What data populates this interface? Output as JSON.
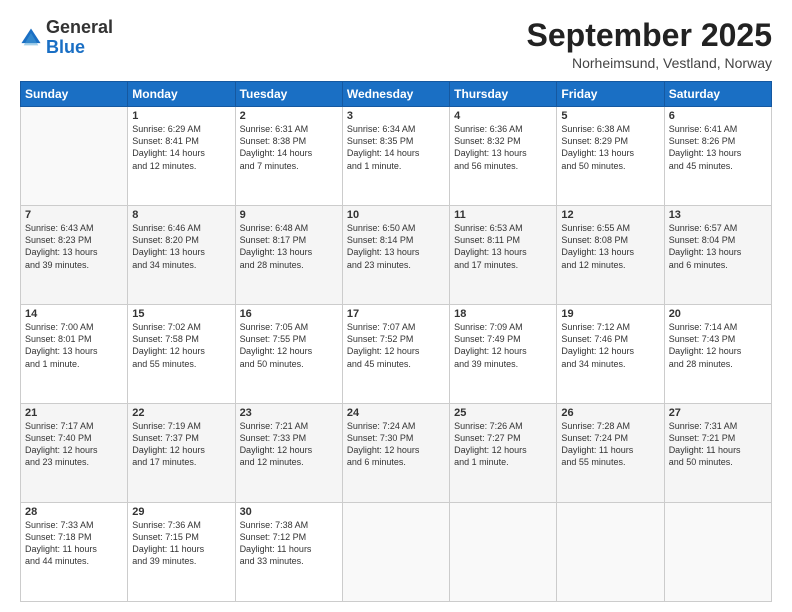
{
  "header": {
    "logo_general": "General",
    "logo_blue": "Blue",
    "month_title": "September 2025",
    "location": "Norheimsund, Vestland, Norway"
  },
  "days_of_week": [
    "Sunday",
    "Monday",
    "Tuesday",
    "Wednesday",
    "Thursday",
    "Friday",
    "Saturday"
  ],
  "weeks": [
    [
      {
        "day": "",
        "content": ""
      },
      {
        "day": "1",
        "content": "Sunrise: 6:29 AM\nSunset: 8:41 PM\nDaylight: 14 hours\nand 12 minutes."
      },
      {
        "day": "2",
        "content": "Sunrise: 6:31 AM\nSunset: 8:38 PM\nDaylight: 14 hours\nand 7 minutes."
      },
      {
        "day": "3",
        "content": "Sunrise: 6:34 AM\nSunset: 8:35 PM\nDaylight: 14 hours\nand 1 minute."
      },
      {
        "day": "4",
        "content": "Sunrise: 6:36 AM\nSunset: 8:32 PM\nDaylight: 13 hours\nand 56 minutes."
      },
      {
        "day": "5",
        "content": "Sunrise: 6:38 AM\nSunset: 8:29 PM\nDaylight: 13 hours\nand 50 minutes."
      },
      {
        "day": "6",
        "content": "Sunrise: 6:41 AM\nSunset: 8:26 PM\nDaylight: 13 hours\nand 45 minutes."
      }
    ],
    [
      {
        "day": "7",
        "content": "Sunrise: 6:43 AM\nSunset: 8:23 PM\nDaylight: 13 hours\nand 39 minutes."
      },
      {
        "day": "8",
        "content": "Sunrise: 6:46 AM\nSunset: 8:20 PM\nDaylight: 13 hours\nand 34 minutes."
      },
      {
        "day": "9",
        "content": "Sunrise: 6:48 AM\nSunset: 8:17 PM\nDaylight: 13 hours\nand 28 minutes."
      },
      {
        "day": "10",
        "content": "Sunrise: 6:50 AM\nSunset: 8:14 PM\nDaylight: 13 hours\nand 23 minutes."
      },
      {
        "day": "11",
        "content": "Sunrise: 6:53 AM\nSunset: 8:11 PM\nDaylight: 13 hours\nand 17 minutes."
      },
      {
        "day": "12",
        "content": "Sunrise: 6:55 AM\nSunset: 8:08 PM\nDaylight: 13 hours\nand 12 minutes."
      },
      {
        "day": "13",
        "content": "Sunrise: 6:57 AM\nSunset: 8:04 PM\nDaylight: 13 hours\nand 6 minutes."
      }
    ],
    [
      {
        "day": "14",
        "content": "Sunrise: 7:00 AM\nSunset: 8:01 PM\nDaylight: 13 hours\nand 1 minute."
      },
      {
        "day": "15",
        "content": "Sunrise: 7:02 AM\nSunset: 7:58 PM\nDaylight: 12 hours\nand 55 minutes."
      },
      {
        "day": "16",
        "content": "Sunrise: 7:05 AM\nSunset: 7:55 PM\nDaylight: 12 hours\nand 50 minutes."
      },
      {
        "day": "17",
        "content": "Sunrise: 7:07 AM\nSunset: 7:52 PM\nDaylight: 12 hours\nand 45 minutes."
      },
      {
        "day": "18",
        "content": "Sunrise: 7:09 AM\nSunset: 7:49 PM\nDaylight: 12 hours\nand 39 minutes."
      },
      {
        "day": "19",
        "content": "Sunrise: 7:12 AM\nSunset: 7:46 PM\nDaylight: 12 hours\nand 34 minutes."
      },
      {
        "day": "20",
        "content": "Sunrise: 7:14 AM\nSunset: 7:43 PM\nDaylight: 12 hours\nand 28 minutes."
      }
    ],
    [
      {
        "day": "21",
        "content": "Sunrise: 7:17 AM\nSunset: 7:40 PM\nDaylight: 12 hours\nand 23 minutes."
      },
      {
        "day": "22",
        "content": "Sunrise: 7:19 AM\nSunset: 7:37 PM\nDaylight: 12 hours\nand 17 minutes."
      },
      {
        "day": "23",
        "content": "Sunrise: 7:21 AM\nSunset: 7:33 PM\nDaylight: 12 hours\nand 12 minutes."
      },
      {
        "day": "24",
        "content": "Sunrise: 7:24 AM\nSunset: 7:30 PM\nDaylight: 12 hours\nand 6 minutes."
      },
      {
        "day": "25",
        "content": "Sunrise: 7:26 AM\nSunset: 7:27 PM\nDaylight: 12 hours\nand 1 minute."
      },
      {
        "day": "26",
        "content": "Sunrise: 7:28 AM\nSunset: 7:24 PM\nDaylight: 11 hours\nand 55 minutes."
      },
      {
        "day": "27",
        "content": "Sunrise: 7:31 AM\nSunset: 7:21 PM\nDaylight: 11 hours\nand 50 minutes."
      }
    ],
    [
      {
        "day": "28",
        "content": "Sunrise: 7:33 AM\nSunset: 7:18 PM\nDaylight: 11 hours\nand 44 minutes."
      },
      {
        "day": "29",
        "content": "Sunrise: 7:36 AM\nSunset: 7:15 PM\nDaylight: 11 hours\nand 39 minutes."
      },
      {
        "day": "30",
        "content": "Sunrise: 7:38 AM\nSunset: 7:12 PM\nDaylight: 11 hours\nand 33 minutes."
      },
      {
        "day": "",
        "content": ""
      },
      {
        "day": "",
        "content": ""
      },
      {
        "day": "",
        "content": ""
      },
      {
        "day": "",
        "content": ""
      }
    ]
  ]
}
